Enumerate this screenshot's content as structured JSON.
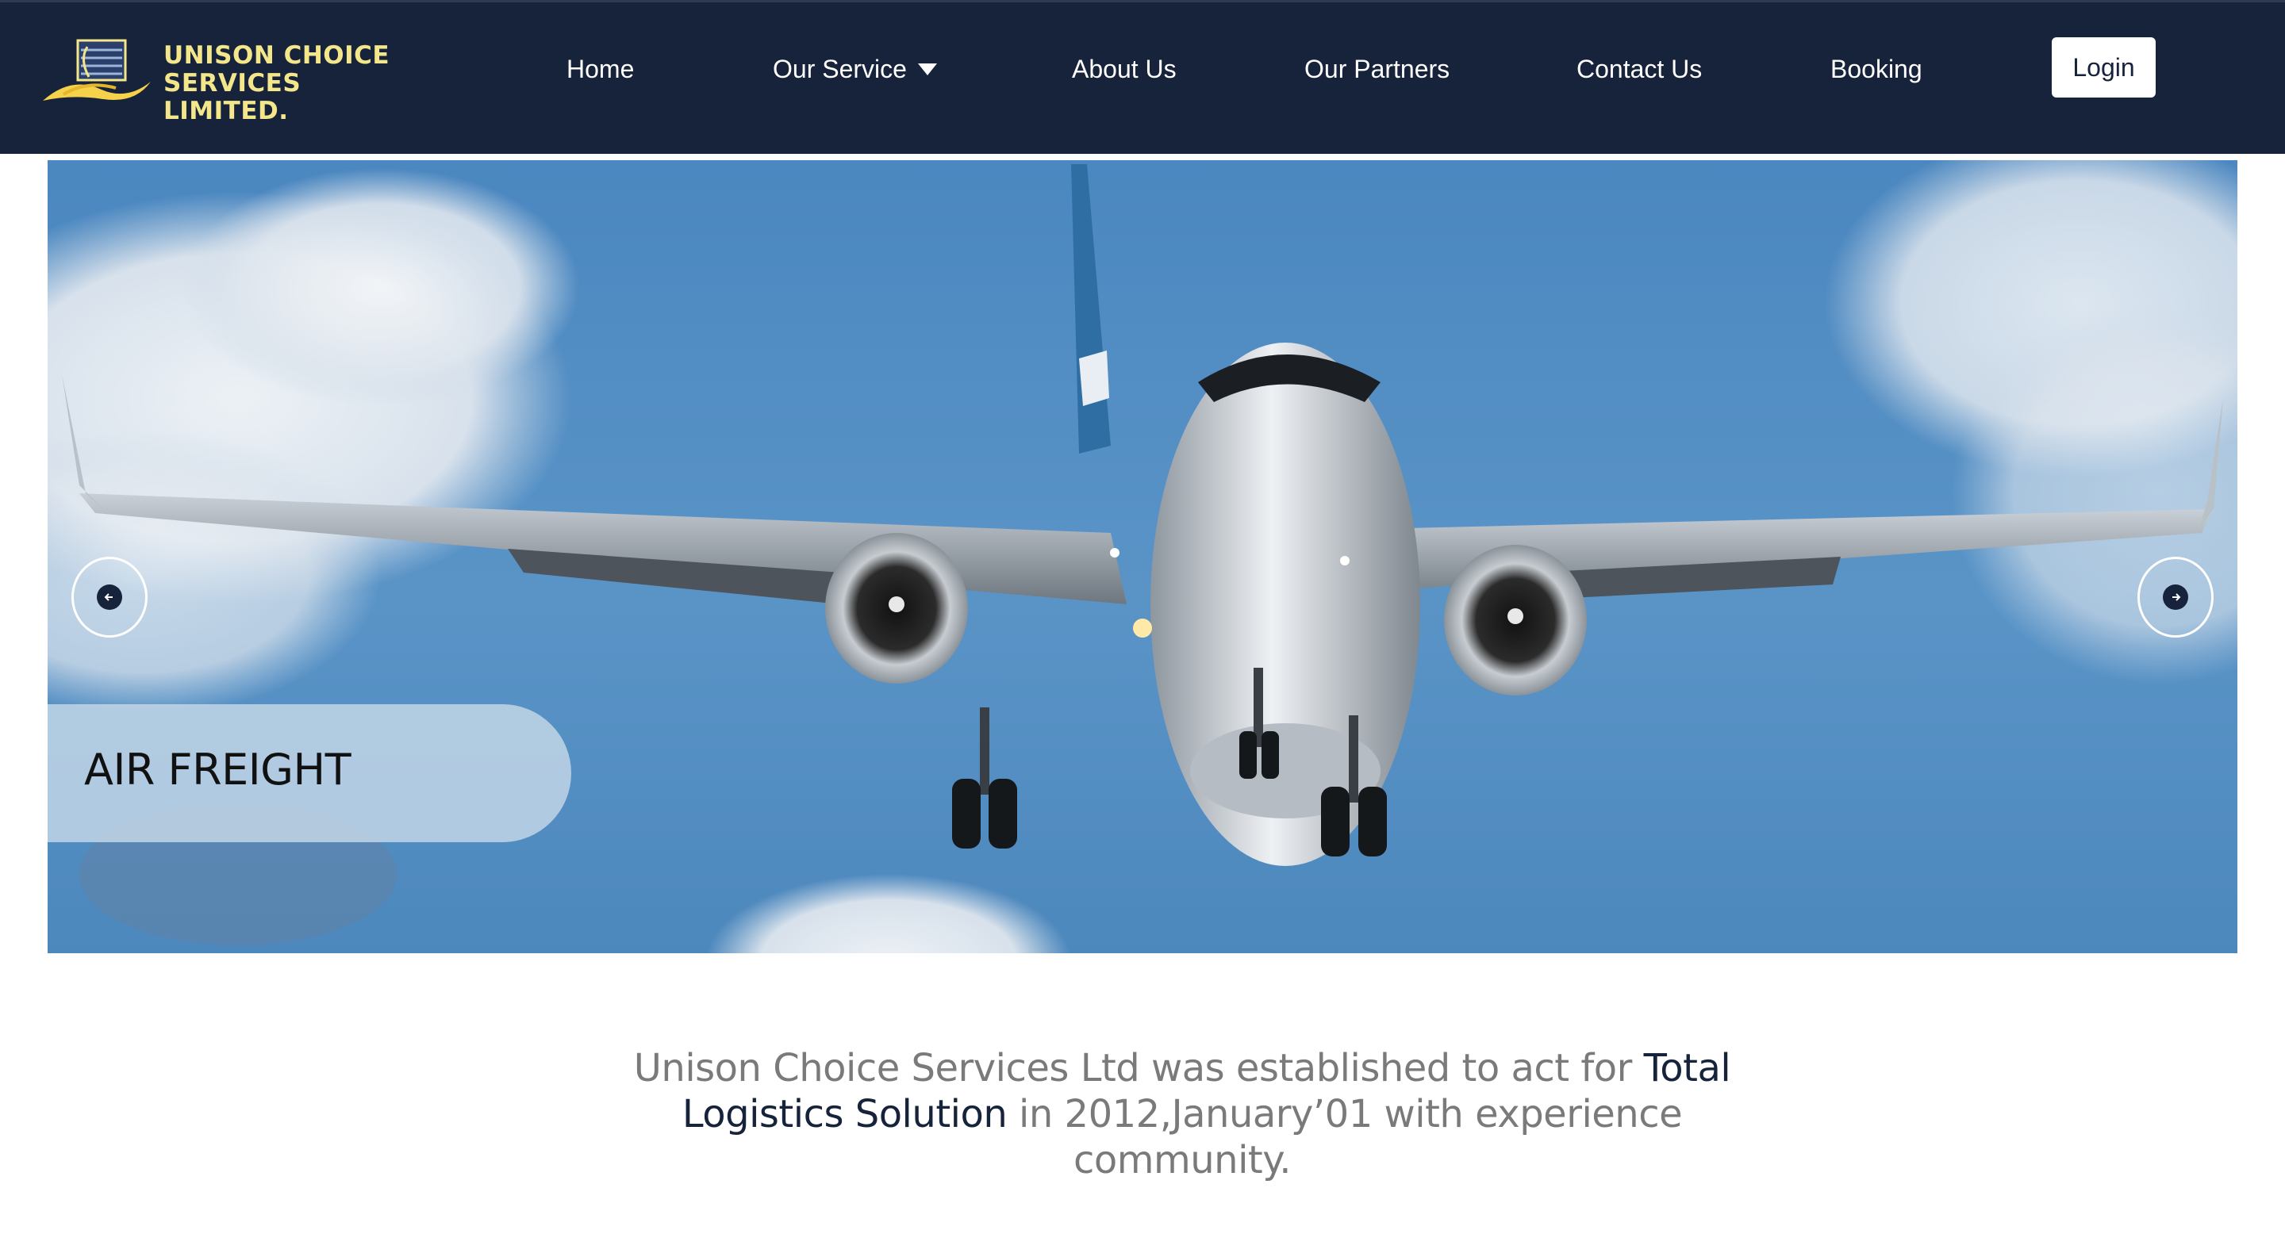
{
  "brand": {
    "line1": "UNISON CHOICE",
    "line2": "SERVICES LIMITED.",
    "icon": "globe-wave-logo"
  },
  "nav": {
    "home": "Home",
    "service": "Our Service",
    "about": "About Us",
    "partners": "Our Partners",
    "contact": "Contact Us",
    "booking": "Booking",
    "login": "Login"
  },
  "hero": {
    "slide_title": "AIR FREIGHT",
    "prev_icon": "arrow-left-icon",
    "next_icon": "arrow-right-icon"
  },
  "intro": {
    "part1": "Unison Choice Services Ltd was established to act for ",
    "highlight": "Total Logistics Solution",
    "part2": " in 2012,January’01 with experience community."
  },
  "colors": {
    "header_bg": "#16233a",
    "brand_gold": "#f4e68a",
    "sky": "#4b87c0"
  }
}
